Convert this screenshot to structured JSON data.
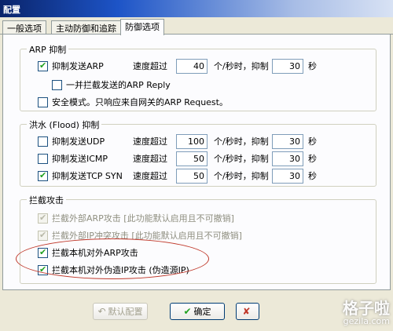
{
  "window": {
    "title": "配置"
  },
  "tabs": [
    {
      "label": "一般选项"
    },
    {
      "label": "主动防御和追踪"
    },
    {
      "label": "防御选项"
    }
  ],
  "arp_group": {
    "title": "ARP 抑制",
    "suppress": {
      "label": "抑制发送ARP",
      "checked": true,
      "rate_label": "速度超过",
      "rate_value": "40",
      "unit_label": "个/秒时，抑制",
      "duration_value": "30",
      "sec_label": "秒"
    },
    "reply": {
      "label": "一并拦截发送的ARP Reply",
      "checked": false
    },
    "safe_mode": {
      "label": "安全模式。只响应来自网关的ARP Request。",
      "checked": false
    }
  },
  "flood_group": {
    "title": "洪水 (Flood) 抑制",
    "rows": [
      {
        "label": "抑制发送UDP",
        "checked": false,
        "rate_label": "速度超过",
        "rate_value": "100",
        "unit_label": "个/秒时，抑制",
        "duration_value": "30",
        "sec_label": "秒"
      },
      {
        "label": "抑制发送ICMP",
        "checked": false,
        "rate_label": "速度超过",
        "rate_value": "50",
        "unit_label": "个/秒时，抑制",
        "duration_value": "30",
        "sec_label": "秒"
      },
      {
        "label": "抑制发送TCP SYN",
        "checked": true,
        "rate_label": "速度超过",
        "rate_value": "50",
        "unit_label": "个/秒时，抑制",
        "duration_value": "30",
        "sec_label": "秒"
      }
    ]
  },
  "block_group": {
    "title": "拦截攻击",
    "rows": [
      {
        "label": "拦截外部ARP攻击 [此功能默认启用且不可撤销]",
        "checked": true,
        "disabled": true
      },
      {
        "label": "拦截外部IP冲突攻击 [此功能默认启用且不可撤销]",
        "checked": true,
        "disabled": true
      },
      {
        "label": "拦截本机对外ARP攻击",
        "checked": true,
        "disabled": false
      },
      {
        "label": "拦截本机对外伪造IP攻击 (伪造源IP)",
        "checked": true,
        "disabled": false
      }
    ]
  },
  "buttons": {
    "default": {
      "label": "默认配置",
      "icon": "undo-icon"
    },
    "ok": {
      "label": "确定",
      "icon": "check-icon"
    }
  },
  "watermark": {
    "line1": "格子啦",
    "line2": "gezila.com"
  },
  "colors": {
    "highlight_oval": "#c0392b",
    "check": "#21a121"
  }
}
